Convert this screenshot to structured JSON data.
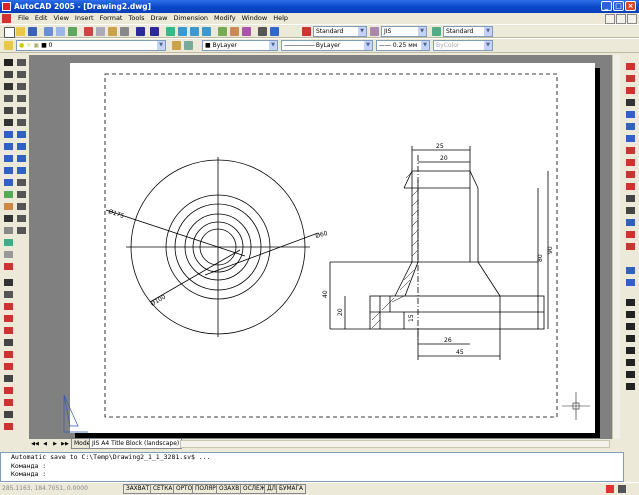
{
  "window": {
    "title": "AutoCAD 2005 - [Drawing2.dwg]",
    "minimize": "_",
    "maximize": "□",
    "close": "×"
  },
  "menu": {
    "items": [
      "File",
      "Edit",
      "View",
      "Insert",
      "Format",
      "Tools",
      "Draw",
      "Dimension",
      "Modify",
      "Window",
      "Help"
    ]
  },
  "toolbar2": {
    "text_style": "Standard",
    "dim_style": "JIS",
    "table_style": "Standard"
  },
  "properties": {
    "layer": "0",
    "color": "ByLayer",
    "linetype": "ByLayer",
    "lineweight": "0.25 мм",
    "plotstyle": "ByColor"
  },
  "drawing": {
    "dims": {
      "d175": "Ø175",
      "d100": "Ø100",
      "d60": "Ø60",
      "w25": "25",
      "w20": "20",
      "h90": "90",
      "h80": "80",
      "h40": "40",
      "h20": "20",
      "h15": "15",
      "w26": "26",
      "w45": "45"
    }
  },
  "tabs": {
    "model": "Model",
    "layout": "JIS A4 Title Block (landscape)"
  },
  "command": {
    "line1": "Automatic save to C:\\Temp\\Drawing2_1_1_3281.sv$ ...",
    "line2": "Команда :",
    "line3": "Команда :"
  },
  "status": {
    "coords": "285.1163, 184.7051, 0.0000",
    "buttons": [
      "ЗАХВАТ",
      "СЕТКА",
      "ОРТО",
      "ПОЛЯР",
      "ОЗАХВ",
      "ОСЛЕЖ",
      "ДЛ",
      "БУМАГА"
    ]
  }
}
